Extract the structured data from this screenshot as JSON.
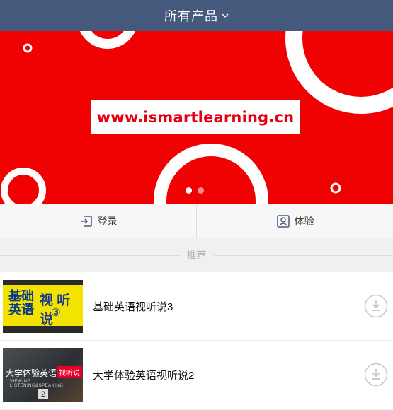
{
  "header": {
    "title": "所有产品",
    "chevron_icon": "chevron-down-icon"
  },
  "banner": {
    "url_text": "www.ismartlearning.cn",
    "background_color": "#f00203",
    "dots": {
      "count": 2,
      "active_index": 0
    }
  },
  "actions": [
    {
      "label": "登录",
      "icon": "login-icon"
    },
    {
      "label": "体验",
      "icon": "user-profile-icon"
    }
  ],
  "section": {
    "label": "推荐"
  },
  "courses": [
    {
      "title": "基础英语视听说3",
      "thumb_texts": {
        "a": "基础\n英语",
        "b": "视 听说",
        "c": "③"
      },
      "action_icon": "download-icon"
    },
    {
      "title": "大学体验英语视听说2",
      "thumb_texts": {
        "a": "大学体验英语",
        "tag": "视听说",
        "b": "VIEWING · LISTENING&SPEAKING",
        "num": "2"
      },
      "action_icon": "download-icon"
    }
  ]
}
